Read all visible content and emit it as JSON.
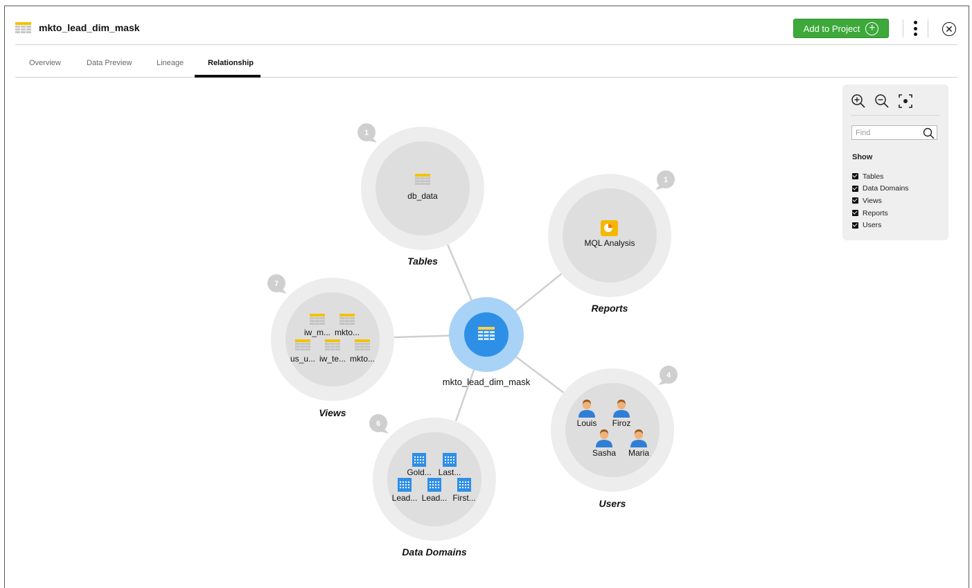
{
  "asset": {
    "title": "mkto_lead_dim_mask",
    "icon": "table-icon"
  },
  "header": {
    "add_button_label": "Add to Project",
    "add_button_icon": "plus-circle-icon",
    "more_icon": "kebab-icon",
    "close_icon": "close-circle-icon"
  },
  "tabs": [
    {
      "label": "Overview",
      "active": false
    },
    {
      "label": "Data Preview",
      "active": false
    },
    {
      "label": "Lineage",
      "active": false
    },
    {
      "label": "Relationship",
      "active": true
    }
  ],
  "graph": {
    "center": {
      "label": "mkto_lead_dim_mask"
    },
    "clusters": {
      "tables": {
        "title": "Tables",
        "count": "1",
        "items": [
          "db_data"
        ]
      },
      "reports": {
        "title": "Reports",
        "count": "1",
        "items": [
          "MQL Analysis"
        ]
      },
      "views": {
        "title": "Views",
        "count": "7",
        "items": [
          "iw_m...",
          "mkto...",
          "us_u...",
          "iw_te...",
          "mkto..."
        ]
      },
      "domains": {
        "title": "Data Domains",
        "count": "6",
        "items": [
          "Gold...",
          "Last...",
          "Lead...",
          "Lead...",
          "First..."
        ]
      },
      "users": {
        "title": "Users",
        "count": "4",
        "items": [
          "Louis",
          "Firoz",
          "Sasha",
          "Maria"
        ]
      }
    }
  },
  "panel": {
    "zoom_in_icon": "zoom-in-icon",
    "zoom_out_icon": "zoom-out-icon",
    "fit_icon": "fit-to-screen-icon",
    "find_placeholder": "Find",
    "show_title": "Show",
    "show_items": [
      "Tables",
      "Data Domains",
      "Views",
      "Reports",
      "Users"
    ]
  },
  "colors": {
    "accent_green": "#3da93a",
    "center_node": "#2e8fe6",
    "center_halo": "#a9d2f7",
    "report_icon": "#f5b800",
    "user_icon": "#2f7fd6"
  }
}
